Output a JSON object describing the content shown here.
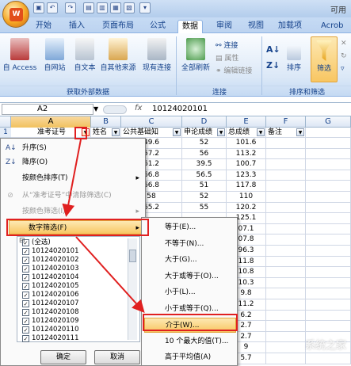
{
  "window": {
    "title_right": "可用"
  },
  "ribbon_tabs": [
    "开始",
    "插入",
    "页面布局",
    "公式",
    "数据",
    "审阅",
    "视图",
    "加载项",
    "Acrob"
  ],
  "ribbon": {
    "get_external": [
      "自 Access",
      "自网站",
      "自文本",
      "自其他来源",
      "现有连接"
    ],
    "get_external_group": "获取外部数据",
    "refresh_all": "全部刷新",
    "connections": [
      "连接",
      "属性",
      "编辑链接"
    ],
    "connections_group": "连接",
    "sort": "排序",
    "filter": "筛选",
    "sort_filter_group": "排序和筛选"
  },
  "formula_bar": {
    "name_box": "A2",
    "fx": "fx",
    "value": "10124020101"
  },
  "columns": [
    "A",
    "B",
    "C",
    "D",
    "E",
    "F",
    "G"
  ],
  "header_row": {
    "row": "1",
    "cells": [
      "准考证号",
      "姓名",
      "公共基础知",
      "申论成绩",
      "总成绩",
      "备注"
    ]
  },
  "rows": [
    {
      "c": "49.6",
      "d": "52",
      "e": "101.6"
    },
    {
      "c": "57.2",
      "d": "56",
      "e": "113.2"
    },
    {
      "c": "61.2",
      "d": "39.5",
      "e": "100.7"
    },
    {
      "c": "66.8",
      "d": "56.5",
      "e": "123.3"
    },
    {
      "c": "66.8",
      "d": "51",
      "e": "117.8"
    },
    {
      "c": "58",
      "d": "52",
      "e": "110"
    },
    {
      "c": "65.2",
      "d": "55",
      "e": "120.2"
    },
    {
      "c": "",
      "d": "",
      "e": "125.1"
    },
    {
      "c": "",
      "d": "",
      "e": "07.1"
    },
    {
      "c": "",
      "d": "",
      "e": "07.8"
    },
    {
      "c": "",
      "d": "",
      "e": "96.3"
    },
    {
      "c": "",
      "d": "",
      "e": "11.8"
    },
    {
      "c": "",
      "d": "",
      "e": "10.8"
    },
    {
      "c": "",
      "d": "",
      "e": "10.3"
    },
    {
      "c": "",
      "d": "",
      "e": "9.8"
    },
    {
      "c": "",
      "d": "",
      "e": "11.2"
    },
    {
      "c": "",
      "d": "",
      "e": "6.2"
    },
    {
      "c": "",
      "d": "",
      "e": "2.7"
    },
    {
      "c": "",
      "d": "",
      "e": "2.7"
    },
    {
      "c": "",
      "d": "",
      "e": "9"
    },
    {
      "c": "",
      "d": "",
      "e": "5.7"
    }
  ],
  "filter_menu": {
    "items": [
      "升序(S)",
      "降序(O)",
      "按颜色排序(T)",
      "从“准考证号”中清除筛选(C)",
      "按颜色筛选(I)",
      "数字筛选(F)"
    ],
    "list": [
      "(全选)",
      "10124020101",
      "10124020102",
      "10124020103",
      "10124020104",
      "10124020105",
      "10124020106",
      "10124020107",
      "10124020108",
      "10124020109",
      "10124020110",
      "10124020111"
    ],
    "ok": "确定",
    "cancel": "取消"
  },
  "number_filter_submenu": [
    "等于(E)...",
    "不等于(N)...",
    "大于(G)...",
    "大于或等于(O)...",
    "小于(L)...",
    "小于或等于(Q)...",
    "介于(W)...",
    "10 个最大的值(T)...",
    "高于平均值(A)"
  ],
  "colors": {
    "highlight": "#f8c662",
    "annotation_red": "#e02020",
    "ribbon_text": "#15428b"
  }
}
